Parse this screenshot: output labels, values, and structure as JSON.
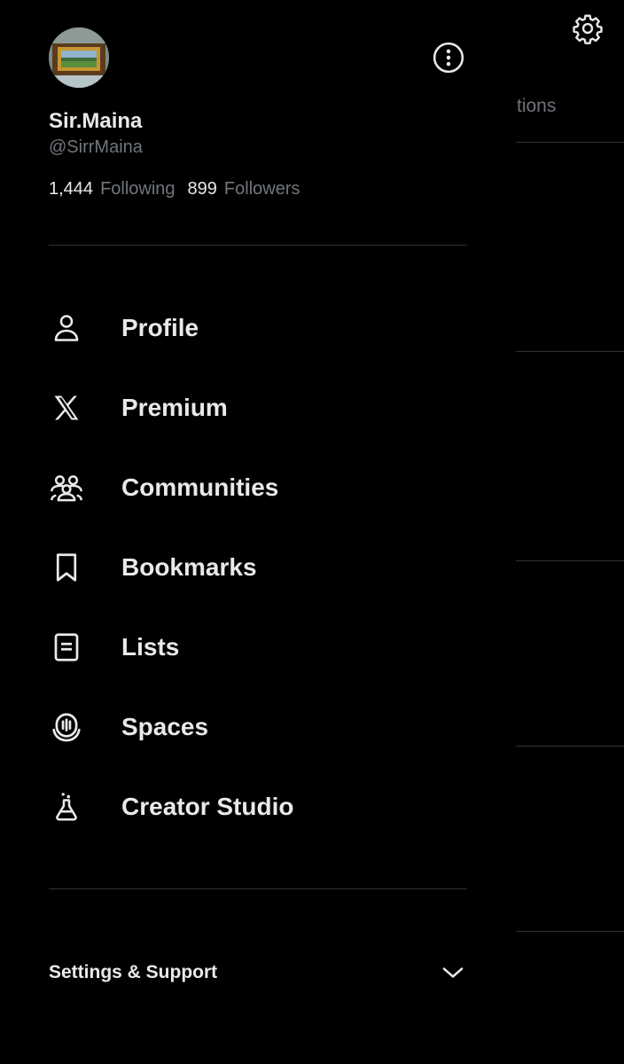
{
  "background": {
    "tab_partial_text": "tions",
    "settings_icon": "gear-icon"
  },
  "drawer": {
    "profile": {
      "display_name": "Sir.Maina",
      "handle": "@SirrMaina",
      "following_count": "1,444",
      "following_label": "Following",
      "followers_count": "899",
      "followers_label": "Followers",
      "avatar_icon": "avatar"
    },
    "more_icon": "more-options-icon",
    "nav": [
      {
        "label": "Profile",
        "icon": "person-icon"
      },
      {
        "label": "Premium",
        "icon": "x-logo-icon"
      },
      {
        "label": "Communities",
        "icon": "communities-icon"
      },
      {
        "label": "Bookmarks",
        "icon": "bookmark-icon"
      },
      {
        "label": "Lists",
        "icon": "list-icon"
      },
      {
        "label": "Spaces",
        "icon": "spaces-icon"
      },
      {
        "label": "Creator Studio",
        "icon": "flask-icon"
      }
    ],
    "settings_support": {
      "label": "Settings & Support",
      "icon": "chevron-down-icon"
    }
  },
  "colors": {
    "background": "#000000",
    "primary_text": "#e7e9ea",
    "secondary_text": "#71767b",
    "divider": "#2f3336"
  }
}
